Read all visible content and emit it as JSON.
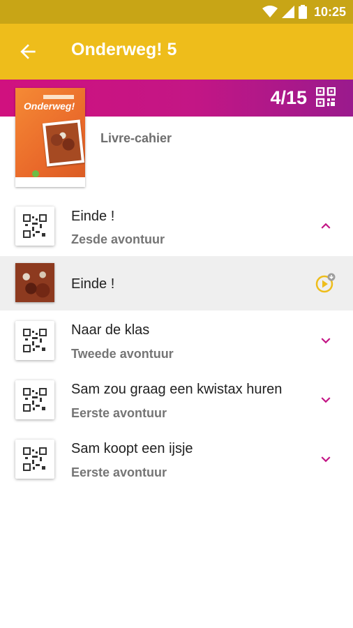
{
  "status_bar": {
    "time": "10:25"
  },
  "app_bar": {
    "title": "Onderweg! 5",
    "back_icon": "arrow-left-icon"
  },
  "banner": {
    "count": "4/15",
    "qr_icon": "qr-code-icon"
  },
  "book": {
    "cover_title": "Onderweg!",
    "type_label": "Livre-cahier"
  },
  "list": {
    "items": [
      {
        "title": "Einde !",
        "subtitle": "Zesde avontuur",
        "state": "expanded"
      },
      {
        "title": "Einde !",
        "subtitle": "",
        "state": "active"
      },
      {
        "title": "Naar de klas",
        "subtitle": "Tweede avontuur",
        "state": "collapsed"
      },
      {
        "title": "Sam zou graag een kwistax huren",
        "subtitle": "Eerste avontuur",
        "state": "collapsed"
      },
      {
        "title": "Sam koopt een ijsje",
        "subtitle": "Eerste avontuur",
        "state": "collapsed"
      }
    ]
  },
  "colors": {
    "app_bar": "#eebd1b",
    "status_bar": "#c8a516",
    "accent": "#c31685",
    "play": "#eebd1b"
  }
}
